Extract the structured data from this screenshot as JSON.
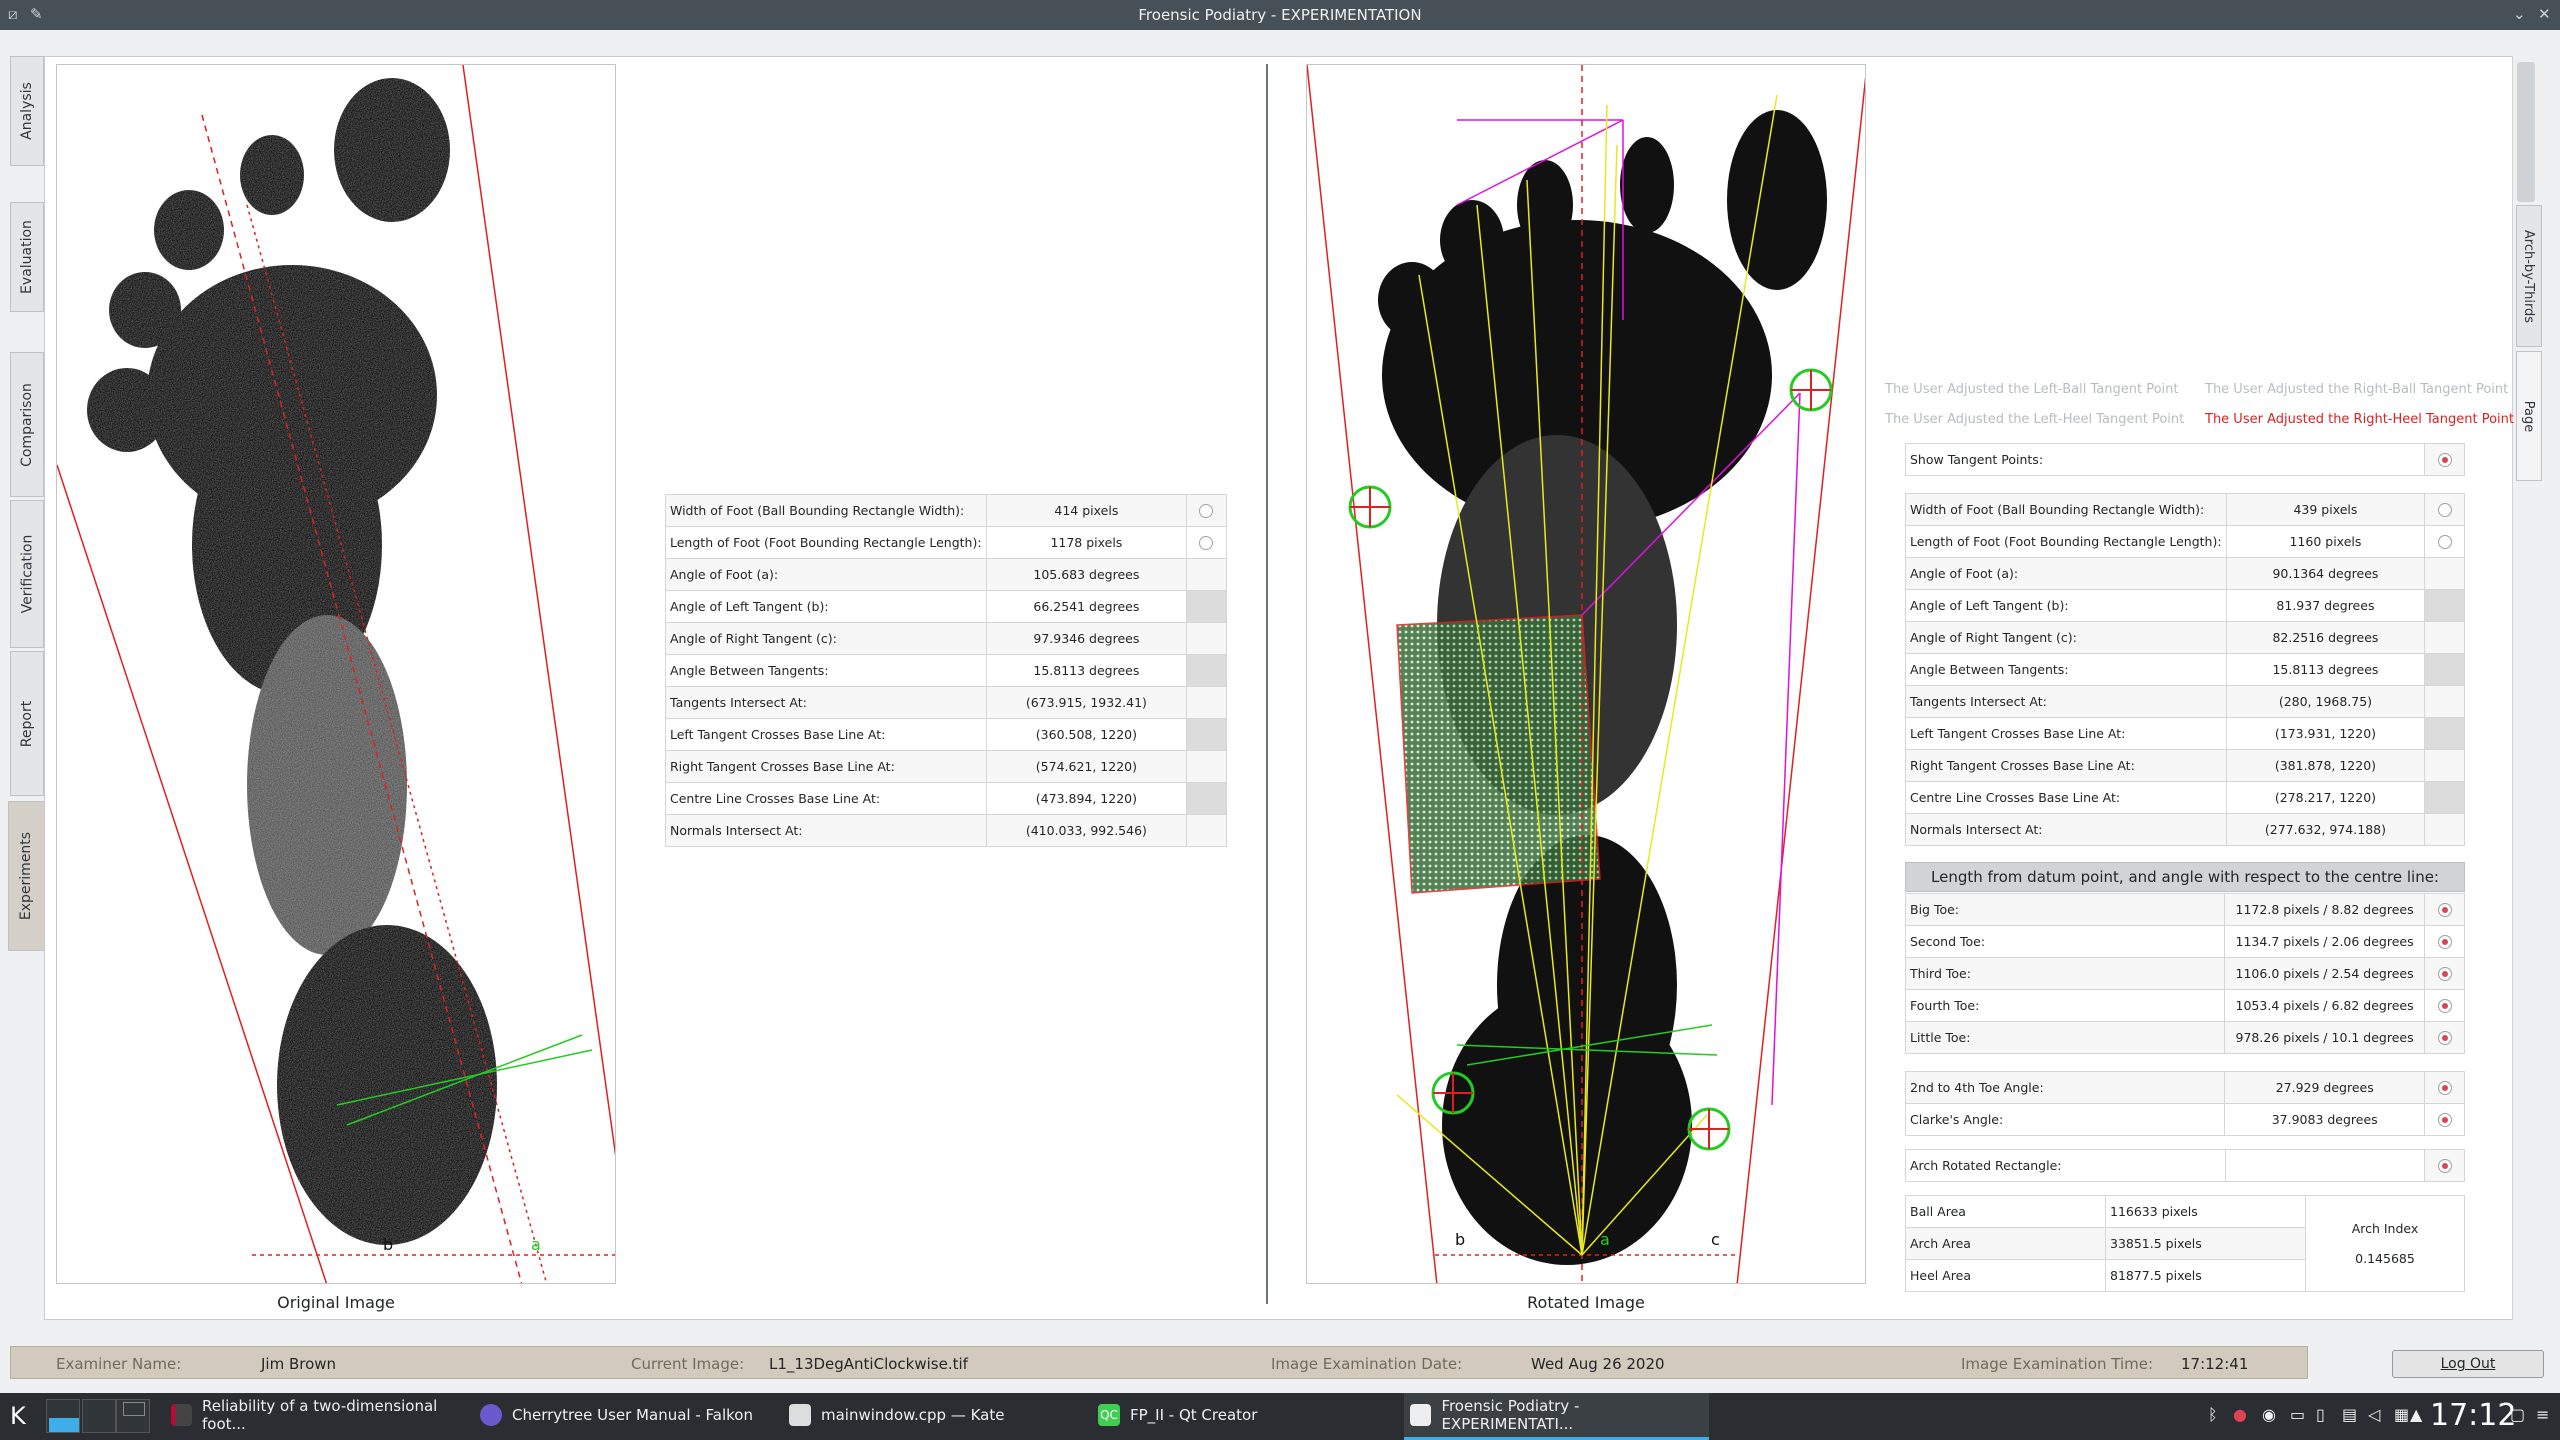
{
  "window": {
    "title": "Froensic Podiatry - EXPERIMENTATION"
  },
  "left_tabs": [
    "Analysis",
    "Evaluation",
    "Comparison",
    "Verification",
    "Report",
    "Experiments"
  ],
  "right_tabs": [
    "Arch-by-Thirds",
    "Page"
  ],
  "original": {
    "caption": "Original Image",
    "marks": {
      "b": "b",
      "a": "a"
    },
    "table": [
      {
        "label": "Width of Foot (Ball Bounding Rectangle Width):",
        "value": "414 pixels"
      },
      {
        "label": "Length of Foot (Foot Bounding Rectangle Length):",
        "value": "1178 pixels"
      },
      {
        "label": "Angle of Foot (a):",
        "value": "105.683 degrees"
      },
      {
        "label": "Angle of Left Tangent (b):",
        "value": "66.2541 degrees"
      },
      {
        "label": "Angle of Right Tangent (c):",
        "value": "97.9346 degrees"
      },
      {
        "label": "Angle Between Tangents:",
        "value": "15.8113 degrees"
      },
      {
        "label": "Tangents Intersect At:",
        "value": "(673.915, 1932.41)"
      },
      {
        "label": "Left Tangent Crosses Base Line At:",
        "value": "(360.508, 1220)"
      },
      {
        "label": "Right Tangent Crosses Base Line At:",
        "value": "(574.621, 1220)"
      },
      {
        "label": "Centre Line Crosses Base Line At:",
        "value": "(473.894, 1220)"
      },
      {
        "label": "Normals Intersect At:",
        "value": "(410.033, 992.546)"
      }
    ]
  },
  "rotated": {
    "caption": "Rotated Image",
    "marks": {
      "b": "b",
      "a": "a",
      "c": "c"
    },
    "hints": {
      "left_ball": "The User Adjusted the Left-Ball Tangent Point",
      "right_ball": "The User Adjusted the Right-Ball Tangent Point",
      "left_heel": "The User Adjusted the Left-Heel Tangent Point",
      "right_heel": "The User Adjusted the Right-Heel Tangent Point"
    },
    "show_tangent": "Show Tangent Points:",
    "table": [
      {
        "label": "Width of Foot (Ball Bounding Rectangle Width):",
        "value": "439 pixels"
      },
      {
        "label": "Length of Foot (Foot Bounding Rectangle Length):",
        "value": "1160 pixels"
      },
      {
        "label": "Angle of Foot (a):",
        "value": "90.1364 degrees"
      },
      {
        "label": "Angle of Left Tangent (b):",
        "value": "81.937 degrees"
      },
      {
        "label": "Angle of Right Tangent (c):",
        "value": "82.2516 degrees"
      },
      {
        "label": "Angle Between Tangents:",
        "value": "15.8113 degrees"
      },
      {
        "label": "Tangents Intersect At:",
        "value": "(280, 1968.75)"
      },
      {
        "label": "Left Tangent Crosses Base Line At:",
        "value": "(173.931, 1220)"
      },
      {
        "label": "Right Tangent Crosses Base Line At:",
        "value": "(381.878, 1220)"
      },
      {
        "label": "Centre Line Crosses Base Line At:",
        "value": "(278.217, 1220)"
      },
      {
        "label": "Normals Intersect At:",
        "value": "(277.632, 974.188)"
      }
    ],
    "toe_header": "Length from datum point, and angle with respect to the centre line:",
    "toes": [
      {
        "label": "Big Toe:",
        "value": "1172.8 pixels  /  8.82 degrees"
      },
      {
        "label": "Second Toe:",
        "value": "1134.7 pixels  /  2.06 degrees"
      },
      {
        "label": "Third Toe:",
        "value": "1106.0 pixels  /  2.54 degrees"
      },
      {
        "label": "Fourth Toe:",
        "value": "1053.4 pixels  /  6.82 degrees"
      },
      {
        "label": "Little Toe:",
        "value": "978.26 pixels  /  10.1 degrees"
      }
    ],
    "angles": [
      {
        "label": "2nd to 4th Toe Angle:",
        "value": "27.929 degrees"
      },
      {
        "label": "Clarke's Angle:",
        "value": "37.9083 degrees"
      }
    ],
    "arch_rect": "Arch Rotated Rectangle:",
    "areas": [
      {
        "label": "Ball Area",
        "value": "116633 pixels"
      },
      {
        "label": "Arch Area",
        "value": "33851.5 pixels"
      },
      {
        "label": "Heel Area",
        "value": "81877.5 pixels"
      }
    ],
    "arch_index_label": "Arch Index",
    "arch_index_value": "0.145685"
  },
  "status": {
    "examiner_label": "Examiner Name:",
    "examiner": "Jim Brown",
    "image_label": "Current Image:",
    "image": "L1_13DegAntiClockwise.tif",
    "date_label": "Image Examination Date:",
    "date": "Wed Aug 26 2020",
    "time_label": "Image Examination Time:",
    "time": "17:12:41",
    "logout": "Log Out"
  },
  "taskbar": {
    "items": [
      "Reliability of a two-dimensional foot...",
      "Cherrytree User Manual - Falkon",
      "mainwindow.cpp  — Kate",
      "FP_II - Qt Creator",
      "Froensic Podiatry - EXPERIMENTATI..."
    ],
    "clock": "17:12"
  },
  "colors": {
    "accent_red": "#e02020",
    "accent_green": "#22cc22",
    "magenta": "#e010e0",
    "yellow": "#e8e820"
  }
}
